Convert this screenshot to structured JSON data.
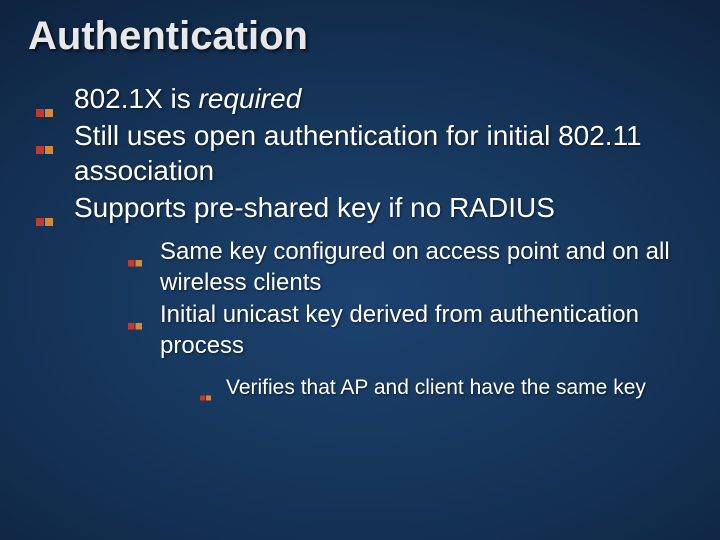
{
  "title": "Authentication",
  "bullets_lvl1": [
    {
      "pre": "802.1X is ",
      "em": "required",
      "post": ""
    },
    {
      "text": "Still uses open authentication for initial 802.11 association"
    },
    {
      "text": "Supports pre-shared key if no RADIUS"
    }
  ],
  "bullets_lvl2": [
    {
      "text": "Same key configured on access point and on all wireless clients"
    },
    {
      "text": "Initial unicast key derived from authentication process"
    }
  ],
  "bullets_lvl3": [
    {
      "text": "Verifies that AP and client have the same key"
    }
  ],
  "bullet_svg": {
    "l1": {
      "w": 22,
      "h": 12
    },
    "l2": {
      "w": 18,
      "h": 10
    },
    "l3": {
      "w": 14,
      "h": 8
    }
  }
}
